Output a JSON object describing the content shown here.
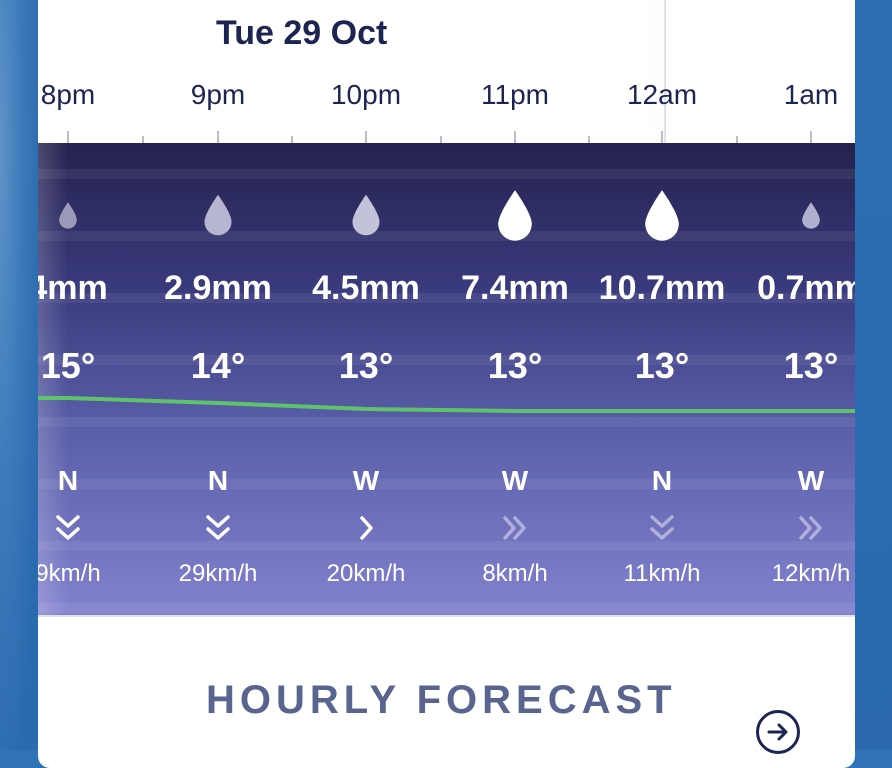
{
  "header": {
    "date": "Tue 29 Oct"
  },
  "hours": [
    {
      "time": "8pm",
      "precip": "4mm",
      "temp": "15°",
      "wind_dir": "N",
      "wind_speed": "9km/h",
      "drop_size": "small",
      "drop_color": "#9a9ab8"
    },
    {
      "time": "9pm",
      "precip": "2.9mm",
      "temp": "14°",
      "wind_dir": "N",
      "wind_speed": "29km/h",
      "drop_size": "medium",
      "drop_color": "#b6b6d0"
    },
    {
      "time": "10pm",
      "precip": "4.5mm",
      "temp": "13°",
      "wind_dir": "W",
      "wind_speed": "20km/h",
      "drop_size": "medium",
      "drop_color": "#c2c2da"
    },
    {
      "time": "11pm",
      "precip": "7.4mm",
      "temp": "13°",
      "wind_dir": "W",
      "wind_speed": "8km/h",
      "drop_size": "large",
      "drop_color": "#ffffff"
    },
    {
      "time": "12am",
      "precip": "10.7mm",
      "temp": "13°",
      "wind_dir": "N",
      "wind_speed": "11km/h",
      "drop_size": "large",
      "drop_color": "#ffffff"
    },
    {
      "time": "1am",
      "precip": "0.7mm",
      "temp": "13°",
      "wind_dir": "W",
      "wind_speed": "12km/h",
      "drop_size": "small",
      "drop_color": "#b0b0cf"
    }
  ],
  "colors": {
    "temp_line": "#5fc36b",
    "title_text": "#1c2452",
    "section_title": "#59658f"
  },
  "section": {
    "title": "HOURLY FORECAST",
    "next_icon": "arrow-right-circle-icon"
  }
}
